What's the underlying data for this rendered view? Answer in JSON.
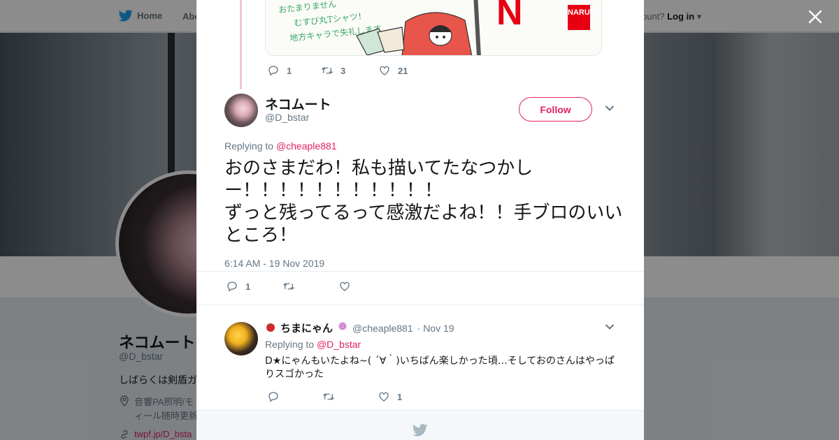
{
  "background_page": {
    "nav": {
      "home_label": "Home",
      "about_label": "Abo",
      "account_prompt": "ccount?",
      "login_label": "Log in"
    },
    "profile": {
      "name": "ネコムート",
      "handle": "@D_bstar",
      "bio": "しばらくは剣盾ガ",
      "location_line1": "音響PA照明/モ",
      "location_line2": "ィール随時更新",
      "link": "twpf.jp/D_bsta"
    }
  },
  "modal": {
    "previous_tweet": {
      "image_text": {
        "line1": "おたまりません",
        "line2": "むすび丸Tシャツ！",
        "line3": "地方キャラで失礼します",
        "logo_letter": "N",
        "logo_tag": "NARUTO"
      },
      "reply_count": "1",
      "retweet_count": "3",
      "like_count": "21"
    },
    "main_tweet": {
      "author_name": "ネコムート",
      "author_handle": "@D_bstar",
      "follow_label": "Follow",
      "replying_prefix": "Replying to ",
      "replying_mention": "@cheaple881",
      "text": "おのさまだわ！私も描いてたなつかしー！！！！！！！！！！！\nずっと残ってるって感激だよね！！手ブロのいいところ！",
      "timestamp": "6:14 AM - 19 Nov 2019",
      "reply_count": "1",
      "retweet_count": "",
      "like_count": ""
    },
    "reply_tweet": {
      "author_name": "ちまにゃん",
      "author_handle": "@cheaple881",
      "date": "· Nov 19",
      "replying_prefix": "Replying to ",
      "replying_mention": "@D_bstar",
      "text": "D★にゃんもいたよね~( ´∀｀)いちばん楽しかった頃…そしておのさんはやっぱりスゴかった",
      "reply_count": "",
      "retweet_count": "",
      "like_count": "1"
    }
  },
  "colors": {
    "accent": "#e0245e",
    "twitter_blue": "#1da1f2",
    "secondary_text": "#657786",
    "thread_line": "#f4c6d3"
  }
}
